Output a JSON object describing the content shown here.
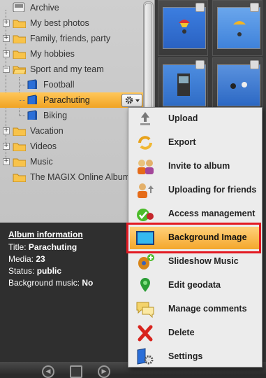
{
  "tree": {
    "items": [
      {
        "label": "Archive"
      },
      {
        "label": "My best photos"
      },
      {
        "label": "Family, friends, party"
      },
      {
        "label": "My hobbies"
      },
      {
        "label": "Sport and my team"
      },
      {
        "label": "Football"
      },
      {
        "label": "Parachuting"
      },
      {
        "label": "Biking"
      },
      {
        "label": "Vacation"
      },
      {
        "label": "Videos"
      },
      {
        "label": "Music"
      },
      {
        "label": "The MAGIX Online Album"
      }
    ],
    "expand_plus": "+",
    "expand_minus": "−"
  },
  "album_info": {
    "heading": "Album information",
    "title_label": "Title:",
    "title_value": "Parachuting",
    "media_label": "Media:",
    "media_value": "23",
    "status_label": "Status:",
    "status_value": "public",
    "music_label": "Background music:",
    "music_value": "No"
  },
  "context_menu": {
    "items": [
      {
        "label": "Upload",
        "icon": "upload-icon"
      },
      {
        "label": "Export",
        "icon": "export-icon"
      },
      {
        "label": "Invite to album",
        "icon": "invite-icon"
      },
      {
        "label": "Uploading for friends",
        "icon": "friends-upload-icon"
      },
      {
        "label": "Access management",
        "icon": "access-icon"
      },
      {
        "label": "Background Image",
        "icon": "background-image-icon"
      },
      {
        "label": "Slideshow Music",
        "icon": "music-icon"
      },
      {
        "label": "Edit geodata",
        "icon": "map-pin-icon"
      },
      {
        "label": "Manage comments",
        "icon": "comments-icon"
      },
      {
        "label": "Delete",
        "icon": "delete-icon"
      },
      {
        "label": "Settings",
        "icon": "settings-icon"
      }
    ],
    "highlighted": "Background Image"
  },
  "colors": {
    "selection": "#f4a72c",
    "highlight_frame": "#e21a23",
    "tree_bg": "#c8c8c8",
    "info_bg": "#2f2f2f"
  }
}
